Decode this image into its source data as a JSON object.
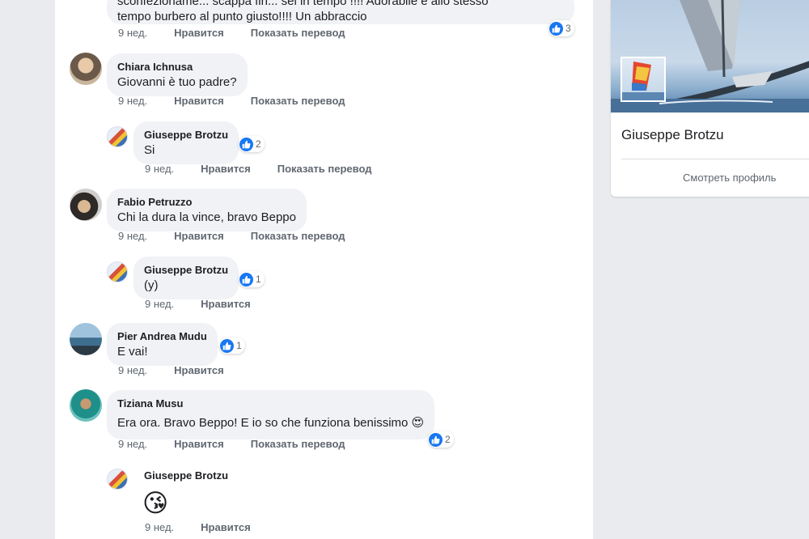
{
  "colors": {
    "like_blue": "#1877f2",
    "bubble_bg": "#f0f2f5",
    "meta_text": "#606770"
  },
  "top_comment": {
    "text_line1": "sconfezioname... scappa fin... sei in tempo !!!! Adorabile e allo stesso",
    "text_line2": "tempo burbero al punto giusto!!!! Un abbraccio",
    "time": "9 нед.",
    "like": "Нравится",
    "translate": "Показать перевод",
    "reactions": "3"
  },
  "comments": [
    {
      "author": "Chiara Ichnusa",
      "text": "Giovanni è tuo padre?",
      "time": "9 нед.",
      "like": "Нравится",
      "translate": "Показать перевод"
    },
    {
      "author": "Giuseppe Brotzu",
      "text": "Si",
      "time": "9 нед.",
      "like": "Нравится",
      "translate": "Показать перевод",
      "reactions": "2"
    },
    {
      "author": "Fabio Petruzzo",
      "text": "Chi la dura la vince, bravo Beppo",
      "time": "9 нед.",
      "like": "Нравится",
      "translate": "Показать перевод"
    },
    {
      "author": "Giuseppe Brotzu",
      "text": "(y)",
      "time": "9 нед.",
      "like": "Нравится",
      "reactions": "1"
    },
    {
      "author": "Pier Andrea Mudu",
      "text": "E vai!",
      "time": "9 нед.",
      "like": "Нравится",
      "reactions": "1"
    },
    {
      "author": "Tiziana Musu",
      "text": "Era ora. Bravo Beppo! E io so che funziona benissimo 😍",
      "time": "9 нед.",
      "like": "Нравится",
      "translate": "Показать перевод",
      "reactions": "2"
    },
    {
      "author": "Giuseppe Brotzu",
      "emoji": "😘",
      "time": "9 нед.",
      "like": "Нравится"
    }
  ],
  "profile_card": {
    "name": "Giuseppe Brotzu",
    "view_profile": "Смотреть профиль"
  }
}
